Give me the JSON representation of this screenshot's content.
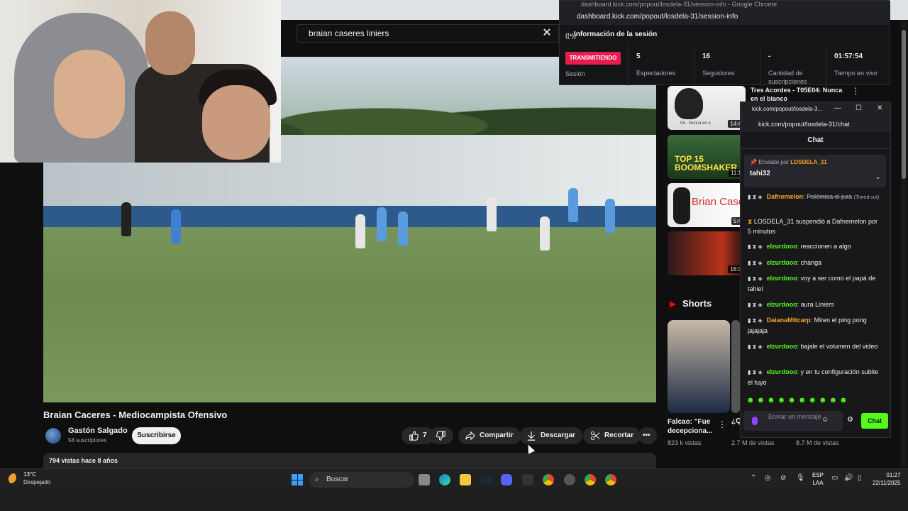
{
  "youtube": {
    "search_value": "braian caseres liniers",
    "video_title": "Braian Caceres - Mediocampista Ofensivo",
    "channel_name": "Gastón Salgado",
    "channel_subs": "58 suscriptores",
    "subscribe_label": "Suscribirse",
    "likes": "7",
    "share_label": "Compartir",
    "download_label": "Descargar",
    "clip_label": "Recortar",
    "views_line": "794 vistas  hace 8 años",
    "rec1_title": "Tres Acordes - T05E04: Nunca en el blanco",
    "rec_durations": [
      "14:4",
      "11:1",
      "5:4",
      "16:3"
    ],
    "rec2_overlay": "TOP 15 BOOMSHAKER",
    "rec3_overlay": "Brian Case",
    "rec1_caption": "04 - Nunca en e",
    "shorts_title": "Shorts",
    "short1_title": "Falcao: \"Fue decepciona...",
    "short1_views": "823 k vistas",
    "short2_title": "¿Q ma",
    "short2_views": "2.7 M de vistas",
    "short3_views": "8.7 M de vistas"
  },
  "session": {
    "tab_title": "dashboard.kick.com/popout/losdela-31/session-info - Google Chrome",
    "url": "dashboard.kick.com/popout/losdela-31/session-info",
    "heading": "Información de la sesión",
    "live_badge": "TRANSMITIENDO",
    "live_label": "Sesión",
    "stats": [
      {
        "value": "5",
        "label": "Espectadores"
      },
      {
        "value": "16",
        "label": "Seguidores"
      },
      {
        "value": "-",
        "label": "Cantidad de suscripciones"
      },
      {
        "value": "01:57:54",
        "label": "Tiempo en vivo"
      }
    ]
  },
  "chat": {
    "tab_title": "kick.com/popout/losdela-3...",
    "url": "kick.com/popout/losdela-31/chat",
    "header": "Chat",
    "pinned_by": "Enviado por",
    "pinned_user": "LOSDELA_31",
    "pinned_text": "tahi32",
    "messages": [
      {
        "user": "Dafnemelon",
        "color": "#f5a623",
        "text": "Polémica el jura",
        "note": "(Timed out)"
      },
      {
        "user": "",
        "color": "",
        "text": "LOSDELA_31 suspendió a Dafnemelon por 5 minutos",
        "note": ""
      },
      {
        "user": "elzurdooo",
        "color": "#53fc18",
        "text": "reaccionen a algo",
        "note": ""
      },
      {
        "user": "elzurdooo",
        "color": "#53fc18",
        "text": "changa",
        "note": ""
      },
      {
        "user": "elzurdooo",
        "color": "#53fc18",
        "text": "voy a ser como el papá de tahiel",
        "note": ""
      },
      {
        "user": "elzurdooo",
        "color": "#53fc18",
        "text": "aura Liniers",
        "note": ""
      },
      {
        "user": "DaianaMttcarp",
        "color": "#f5a623",
        "text": "Miren el ping pong jajajaja",
        "note": ""
      },
      {
        "user": "elzurdooo",
        "color": "#53fc18",
        "text": "bajale el volumen del video",
        "note": ""
      },
      {
        "user": "elzurdooo",
        "color": "#53fc18",
        "text": "y en tu configuración subite el tuyo",
        "note": ""
      }
    ],
    "input_placeholder": "Enviar un mensaje",
    "send_label": "Chat"
  },
  "taskbar": {
    "weather_temp": "13°C",
    "weather_desc": "Despejado",
    "search_label": "Buscar",
    "lang_top": "ESP",
    "lang_bottom": "LAA",
    "time": "01:27",
    "date": "22/11/2025"
  },
  "colors": {
    "kick_green": "#53fc18",
    "live_red": "#e81c4f",
    "yt_bg": "#0f0f0f"
  }
}
